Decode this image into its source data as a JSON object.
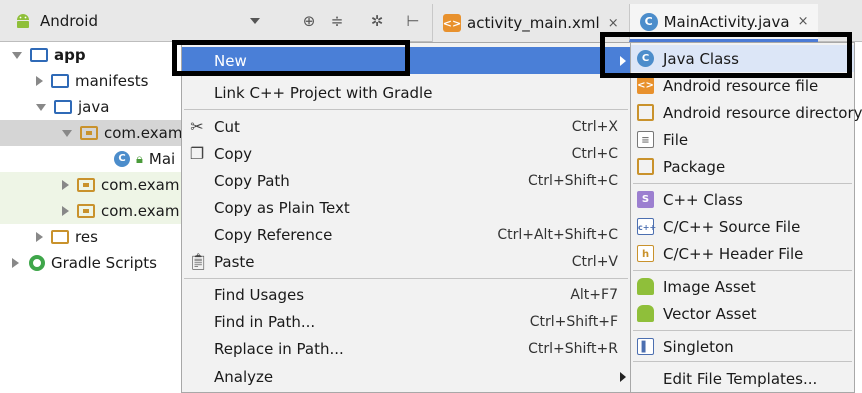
{
  "toolbar": {
    "project_view": "Android",
    "tabs": [
      {
        "label": "activity_main.xml",
        "close": "×"
      },
      {
        "label": "MainActivity.java",
        "close": "×"
      }
    ]
  },
  "tree": {
    "items": [
      {
        "label": "app"
      },
      {
        "label": "manifests"
      },
      {
        "label": "java"
      },
      {
        "label": "com.exam"
      },
      {
        "label": "Mai"
      },
      {
        "label": "com.exam"
      },
      {
        "label": "com.exam"
      },
      {
        "label": "res"
      },
      {
        "label": "Gradle Scripts"
      }
    ]
  },
  "context_menu": {
    "items": [
      {
        "label": "New",
        "shortcut": ""
      },
      {
        "label": "Link C++ Project with Gradle",
        "shortcut": ""
      },
      {
        "label": "Cut",
        "shortcut": "Ctrl+X"
      },
      {
        "label": "Copy",
        "shortcut": "Ctrl+C"
      },
      {
        "label": "Copy Path",
        "shortcut": "Ctrl+Shift+C"
      },
      {
        "label": "Copy as Plain Text",
        "shortcut": ""
      },
      {
        "label": "Copy Reference",
        "shortcut": "Ctrl+Alt+Shift+C"
      },
      {
        "label": "Paste",
        "shortcut": "Ctrl+V"
      },
      {
        "label": "Find Usages",
        "shortcut": "Alt+F7"
      },
      {
        "label": "Find in Path...",
        "shortcut": "Ctrl+Shift+F"
      },
      {
        "label": "Replace in Path...",
        "shortcut": "Ctrl+Shift+R"
      },
      {
        "label": "Analyze",
        "shortcut": ""
      }
    ]
  },
  "new_submenu": {
    "items": [
      {
        "label": "Java Class"
      },
      {
        "label": "Android resource file"
      },
      {
        "label": "Android resource directory"
      },
      {
        "label": "File"
      },
      {
        "label": "Package"
      },
      {
        "label": "C++ Class"
      },
      {
        "label": "C/C++ Source File"
      },
      {
        "label": "C/C++ Header File"
      },
      {
        "label": "Image Asset"
      },
      {
        "label": "Vector Asset"
      },
      {
        "label": "Singleton"
      },
      {
        "label": "Edit File Templates..."
      }
    ]
  },
  "colors": {
    "menu_highlight": "#4a7fd7",
    "android_green": "#8fbf3a",
    "folder_blue": "#2f6ab7",
    "package_orange": "#c9922c",
    "annotation_box": "#000000"
  }
}
